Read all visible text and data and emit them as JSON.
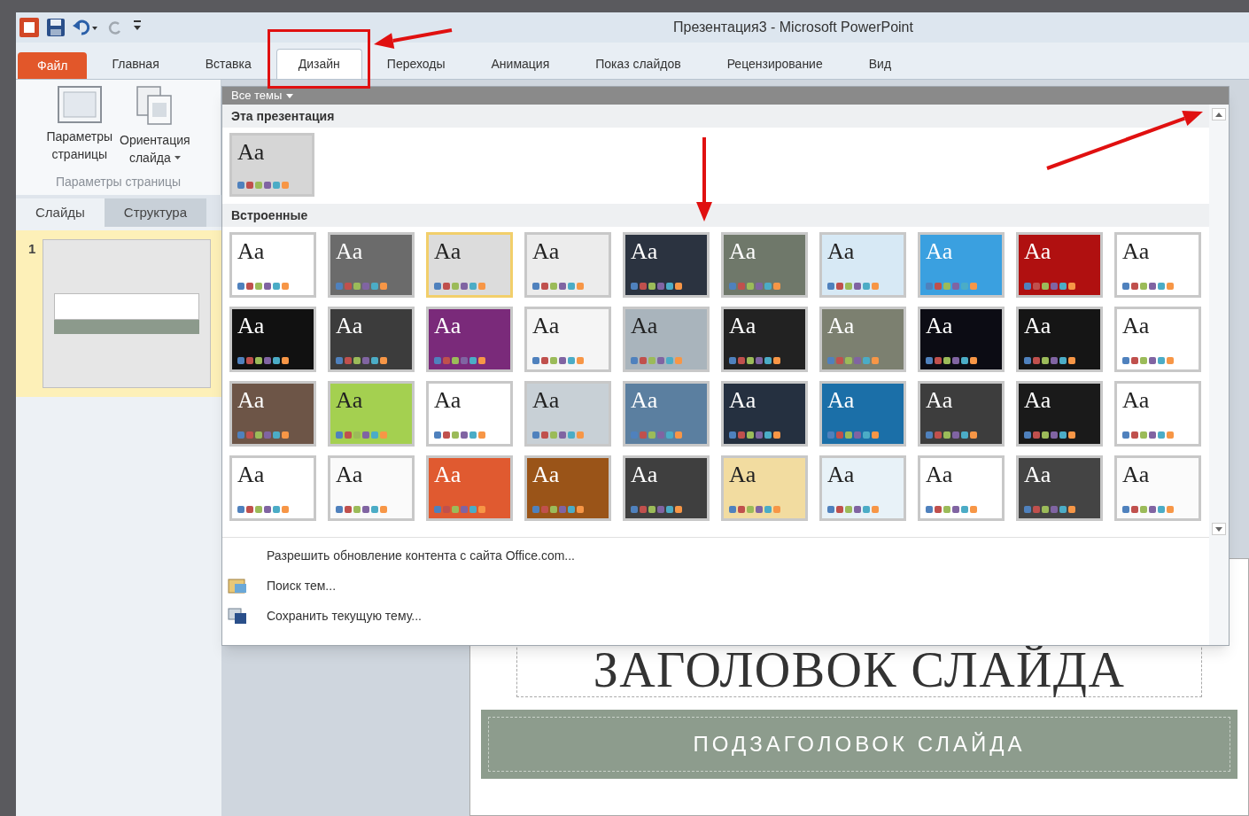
{
  "window": {
    "title": "Презентация3 - Microsoft PowerPoint"
  },
  "tabs": [
    {
      "label": "Файл",
      "kind": "file",
      "selected": false
    },
    {
      "label": "Главная",
      "kind": "tab",
      "selected": false
    },
    {
      "label": "Вставка",
      "kind": "tab",
      "selected": false
    },
    {
      "label": "Дизайн",
      "kind": "tab",
      "selected": true
    },
    {
      "label": "Переходы",
      "kind": "tab",
      "selected": false
    },
    {
      "label": "Анимация",
      "kind": "tab",
      "selected": false
    },
    {
      "label": "Показ слайдов",
      "kind": "tab",
      "selected": false
    },
    {
      "label": "Рецензирование",
      "kind": "tab",
      "selected": false
    },
    {
      "label": "Вид",
      "kind": "tab",
      "selected": false
    }
  ],
  "ribbon": {
    "buttons": [
      {
        "kind": "page",
        "lines": [
          "Параметры",
          "страницы"
        ],
        "dropdown": false
      },
      {
        "kind": "orientation",
        "lines": [
          "Ориентация",
          "слайда"
        ],
        "dropdown": true
      }
    ],
    "group_label": "Параметры страницы"
  },
  "panel_tabs": [
    {
      "label": "Слайды",
      "selected": true
    },
    {
      "label": "Структура",
      "selected": false
    }
  ],
  "slides": [
    {
      "number": "1",
      "selected": true
    }
  ],
  "gallery": {
    "header": "Все темы",
    "sections": [
      {
        "title": "Эта презентация",
        "themes": [
          {
            "label": "Aa",
            "color": "#d6d6d6",
            "selected": false
          }
        ]
      },
      {
        "title": "Встроенные",
        "themes": [
          {
            "label": "Aa",
            "color": "#ffffff",
            "selected": false
          },
          {
            "label": "Aa",
            "color": "#6b6b6b",
            "selected": false
          },
          {
            "label": "Aa",
            "color": "#dcdcdc",
            "selected": true
          },
          {
            "label": "Aa",
            "color": "#ececec",
            "selected": false
          },
          {
            "label": "Aa",
            "color": "#2b3340",
            "selected": false
          },
          {
            "label": "Aa",
            "color": "#6f786a",
            "selected": false
          },
          {
            "label": "Aa",
            "color": "#d7e9f5",
            "selected": false
          },
          {
            "label": "Aa",
            "color": "#3aa0e0",
            "selected": false
          },
          {
            "label": "Aa",
            "color": "#b01010",
            "selected": false
          },
          {
            "label": "Aa",
            "color": "#ffffff",
            "selected": false
          },
          {
            "label": "Aa",
            "color": "#111111",
            "selected": false
          },
          {
            "label": "Aa",
            "color": "#3c3c3c",
            "selected": false
          },
          {
            "label": "Aa",
            "color": "#7a2a7a",
            "selected": false
          },
          {
            "label": "Aa",
            "color": "#f5f5f5",
            "selected": false
          },
          {
            "label": "Aa",
            "color": "#a9b4bc",
            "selected": false
          },
          {
            "label": "Aa",
            "color": "#222222",
            "selected": false
          },
          {
            "label": "Aa",
            "color": "#7c8070",
            "selected": false
          },
          {
            "label": "Aa",
            "color": "#0c0c14",
            "selected": false
          },
          {
            "label": "Aa",
            "color": "#151515",
            "selected": false
          },
          {
            "label": "Aa",
            "color": "#ffffff",
            "selected": false
          },
          {
            "label": "Aa",
            "color": "#6d5547",
            "selected": false
          },
          {
            "label": "Aa",
            "color": "#a4d050",
            "selected": false
          },
          {
            "label": "Aa",
            "color": "#ffffff",
            "selected": false
          },
          {
            "label": "Aa",
            "color": "#c8d0d6",
            "selected": false
          },
          {
            "label": "Aa",
            "color": "#5b7fa0",
            "selected": false
          },
          {
            "label": "Aa",
            "color": "#253040",
            "selected": false
          },
          {
            "label": "Aa",
            "color": "#1b6fa8",
            "selected": false
          },
          {
            "label": "Aa",
            "color": "#3d3d3d",
            "selected": false
          },
          {
            "label": "Aa",
            "color": "#1a1a1a",
            "selected": false
          },
          {
            "label": "Aa",
            "color": "#ffffff",
            "selected": false
          },
          {
            "label": "Aa",
            "color": "#ffffff",
            "selected": false
          },
          {
            "label": "Aa",
            "color": "#fafafa",
            "selected": false
          },
          {
            "label": "Aa",
            "color": "#e05a30",
            "selected": false
          },
          {
            "label": "Aa",
            "color": "#9a5418",
            "selected": false
          },
          {
            "label": "Aa",
            "color": "#3f3f3f",
            "selected": false
          },
          {
            "label": "Aa",
            "color": "#f2dca0",
            "selected": false
          },
          {
            "label": "Aa",
            "color": "#e8f2f8",
            "selected": false
          },
          {
            "label": "Aa",
            "color": "#ffffff",
            "selected": false
          },
          {
            "label": "Aa",
            "color": "#444444",
            "selected": false
          },
          {
            "label": "Aa",
            "color": "#fbfbfb",
            "selected": false
          }
        ]
      }
    ],
    "menu": [
      {
        "label": "Разрешить обновление контента с сайта Office.com...",
        "kind": "plain"
      },
      {
        "label": "Поиск тем...",
        "kind": "browse"
      },
      {
        "label": "Сохранить текущую тему...",
        "kind": "save"
      }
    ]
  },
  "slide": {
    "title": "ЗАГОЛОВОК СЛАЙДА",
    "subtitle": "ПОДЗАГОЛОВОК СЛАЙДА"
  }
}
